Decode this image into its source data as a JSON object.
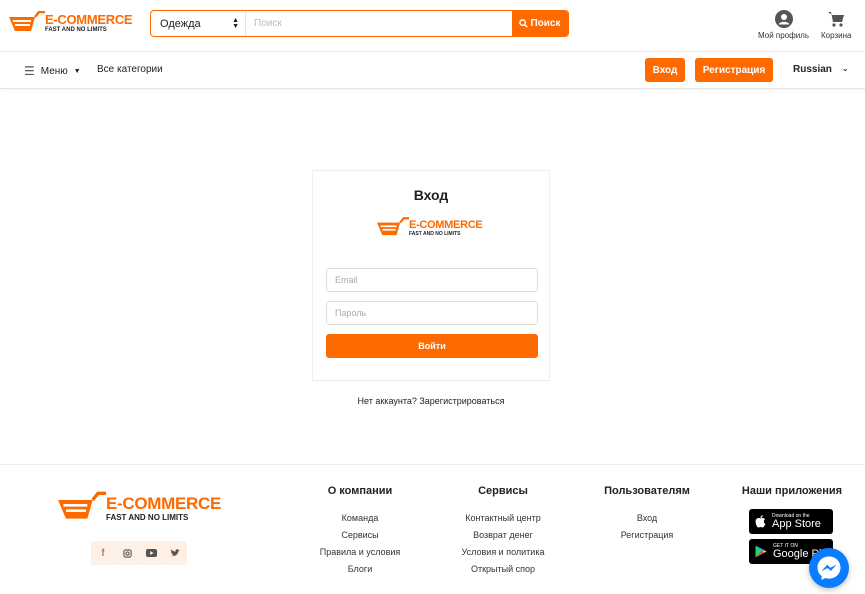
{
  "brand": {
    "name": "E-COMMERCE",
    "tagline": "FAST AND NO LIMITS",
    "accent": "#ff6a00"
  },
  "search": {
    "category": "Одежда",
    "placeholder": "Поиск",
    "button_label": "Поиск"
  },
  "header_actions": {
    "profile_label": "Мой профиль",
    "cart_label": "Корзина"
  },
  "nav": {
    "menu_label": "Меню",
    "all_categories": "Все категории",
    "login_label": "Вход",
    "register_label": "Регистрация",
    "language": "Russian"
  },
  "login": {
    "title": "Вход",
    "email_placeholder": "Email",
    "password_placeholder": "Пароль",
    "submit_label": "Войти",
    "no_account_text": "Нет аккаунта? Зарегистрироваться"
  },
  "footer": {
    "social_icons": [
      "facebook-icon",
      "instagram-icon",
      "youtube-icon",
      "twitter-icon"
    ],
    "columns": [
      {
        "title": "О компании",
        "links": [
          "Команда",
          "Сервисы",
          "Правила и условия",
          "Блоги"
        ]
      },
      {
        "title": "Сервисы",
        "links": [
          "Контактный центр",
          "Возврат денег",
          "Условия и политика",
          "Открытый спор"
        ]
      },
      {
        "title": "Пользователям",
        "links": [
          "Вход",
          "Регистрация"
        ]
      },
      {
        "title": "Наши приложения",
        "links": []
      }
    ],
    "app_store": {
      "small": "Download on the",
      "big": "App Store"
    },
    "google_play": {
      "small": "GET IT ON",
      "big": "Google Play"
    }
  }
}
